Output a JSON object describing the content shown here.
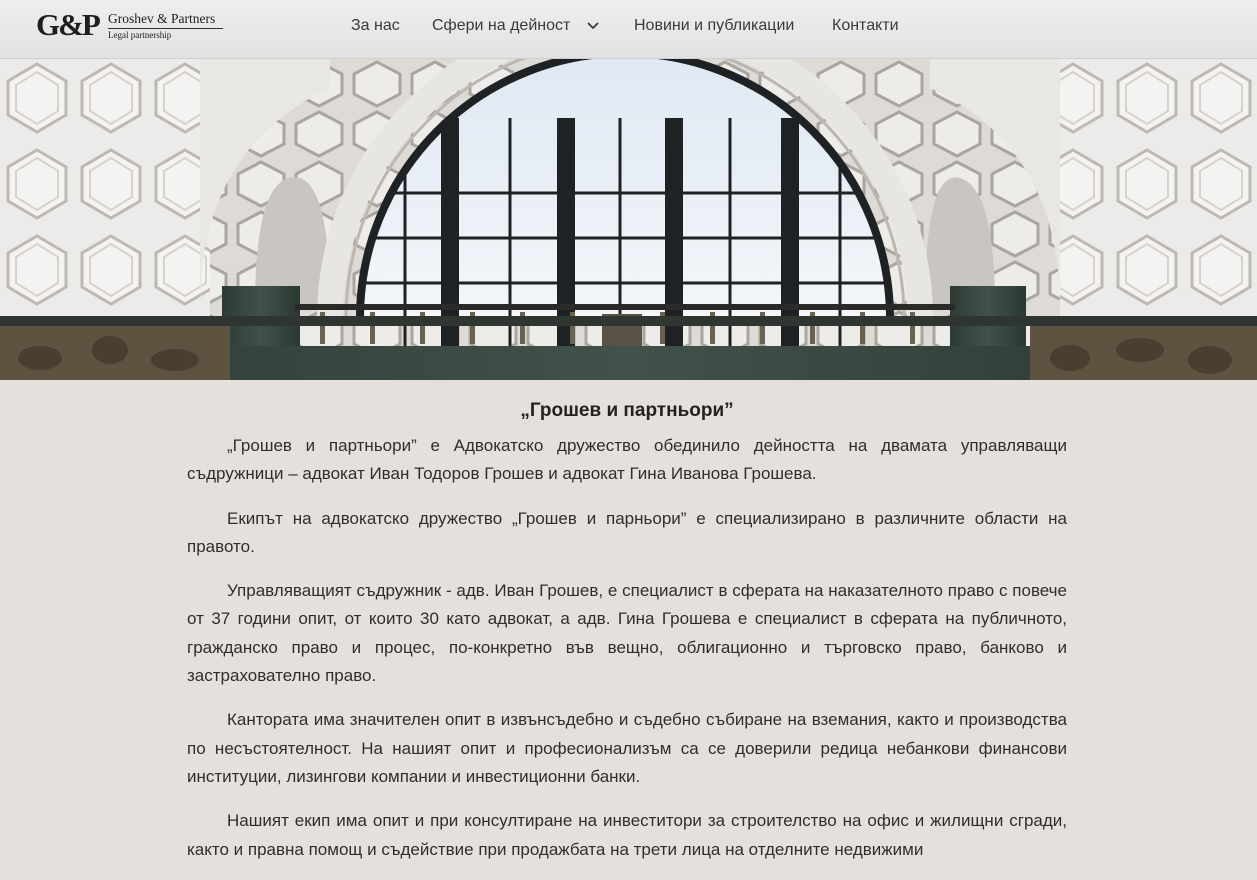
{
  "header": {
    "logo_mark": "G&P",
    "logo_name": "Groshev & Partners",
    "logo_sub": "Legal partnership",
    "nav": [
      {
        "label": "За нас"
      },
      {
        "label": "Сфери на дейност"
      },
      {
        "label": "Новини и публикации"
      },
      {
        "label": "Контакти"
      }
    ]
  },
  "hero": {
    "icon": "building-interior-photo"
  },
  "main": {
    "title": "„Грошев и партньори”",
    "paragraphs": [
      "„Грошев и партньори” е Адвокатско дружество обединило дейността на двамата управляващи съдружници – адвокат Иван Тодоров Грошев и адвокат Гина Иванова Грошева.",
      "Екипът на адвокатско дружество „Грошев и парньори” е специализирано в различните области на правото.",
      "Управляващият съдружник - адв. Иван Грошев, е специалист в сферата на наказателното право с повече от 37 години опит, от които 30 като адвокат, а адв. Гина Грошева е специалист в сферата на публичното, гражданско право и процес, по-конкретно във вещно, облигационно и търговско право, банково и застрахователно право.",
      "Кантората има значителен опит в извънсъдебно и съдебно събиране на вземания, както и производства по несъстоятелност. На нашият опит и професионализъм са се доверили редица небанкови финансови институции, лизингови компании и инвестиционни банки.",
      "Нашият екип има опит и при консултиране на инвеститори за строителство на офис и жилищни сгради, както и правна помощ и съдействие при продажбата на трети лица на отделните недвижими"
    ]
  }
}
